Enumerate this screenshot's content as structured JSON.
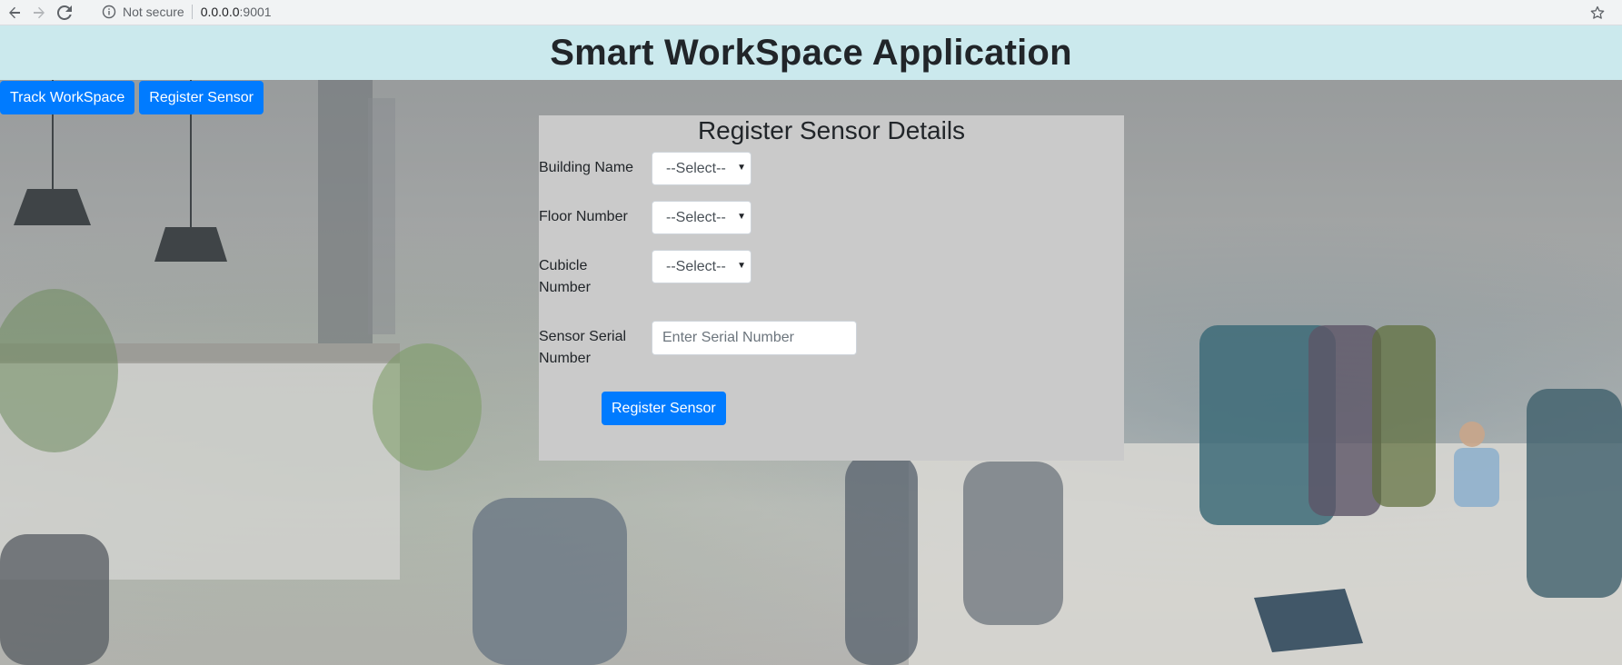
{
  "browser": {
    "security_label": "Not secure",
    "url_host": "0.0.0.0",
    "url_port": ":9001"
  },
  "header": {
    "title": "Smart WorkSpace Application"
  },
  "nav": {
    "track_label": "Track WorkSpace",
    "register_label": "Register Sensor"
  },
  "form": {
    "title": "Register Sensor Details",
    "building_label": "Building Name",
    "building_value": "--Select--",
    "floor_label": "Floor Number",
    "floor_value": "--Select--",
    "cubicle_label": "Cubicle Number",
    "cubicle_value": "--Select--",
    "serial_label": "Sensor Serial Number",
    "serial_placeholder": "Enter Serial Number",
    "submit_label": "Register Sensor"
  }
}
